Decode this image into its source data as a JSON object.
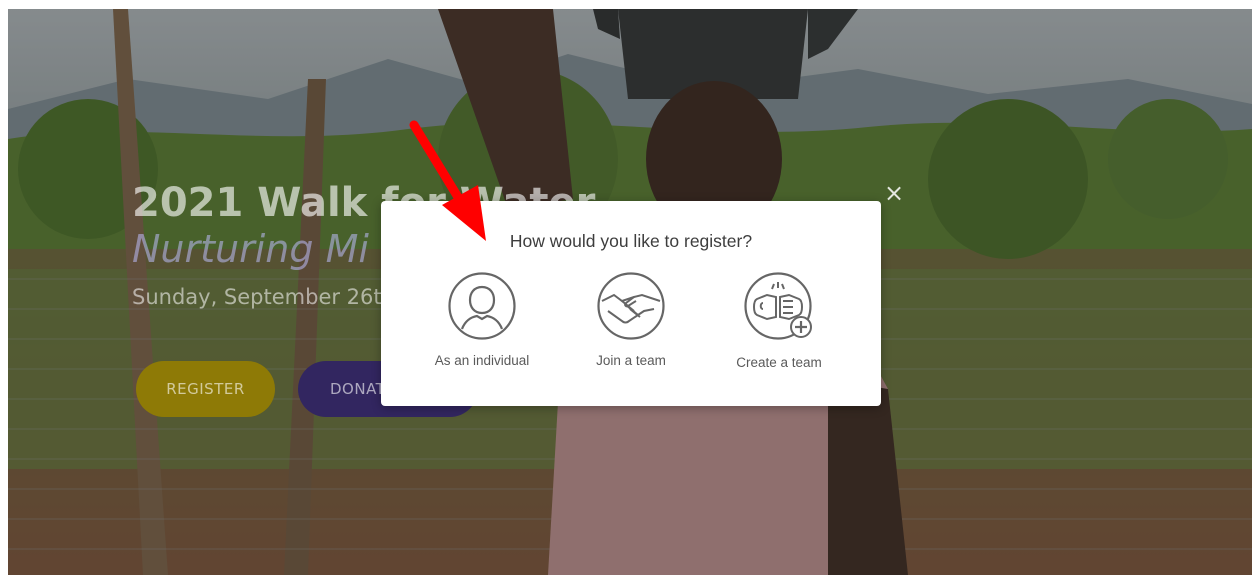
{
  "hero": {
    "title": "2021 Walk for Water",
    "subtitle": "Nurturing Mi",
    "date": "Sunday, September 26t",
    "register_label": "REGISTER",
    "donate_label": "DONAT"
  },
  "modal": {
    "title": "How would you like to register?",
    "close_glyph": "×",
    "options": [
      {
        "label": "As an individual",
        "icon": "person-icon"
      },
      {
        "label": "Join a team",
        "icon": "handshake-icon"
      },
      {
        "label": "Create a team",
        "icon": "fist-bump-plus-icon"
      }
    ]
  },
  "colors": {
    "register_button": "#8e7a06",
    "donate_button": "#322660",
    "icon_stroke": "#666666",
    "annotation_arrow": "#ff0000"
  }
}
